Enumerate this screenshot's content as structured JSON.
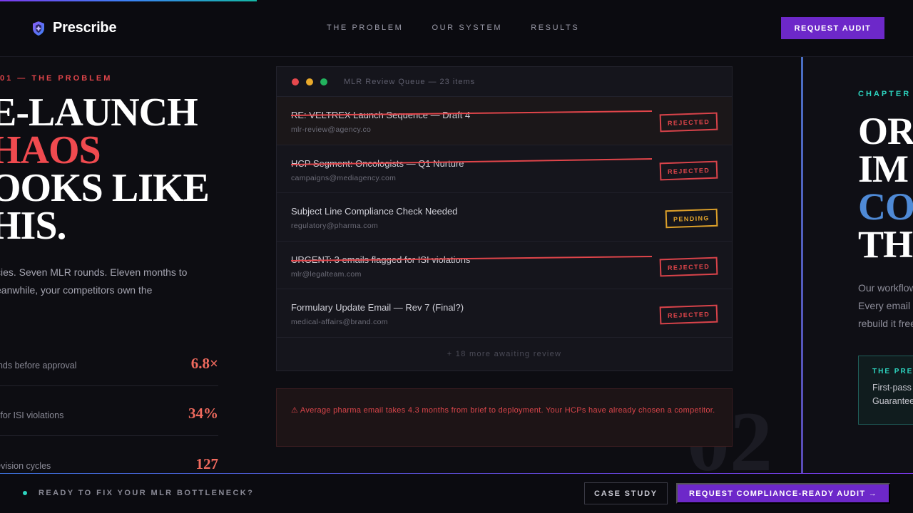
{
  "brand": {
    "name": "Prescribe",
    "logo_icon": "shield-pill-icon"
  },
  "nav": {
    "items": [
      "THE PROBLEM",
      "OUR SYSTEM",
      "RESULTS"
    ]
  },
  "header": {
    "cta_label": "REQUEST AUDIT"
  },
  "colors": {
    "accent": "#6d28c9",
    "danger": "#e0454a",
    "teal": "#2dd4bf",
    "warning": "#e3a52c",
    "blue": "#4f8ad6"
  },
  "problem": {
    "chapter": "01 — THE PROBLEM",
    "headline": {
      "line1": "E-LAUNCH",
      "line2": "HAOS",
      "line3": "OOKS LIKE",
      "line4": "HIS."
    },
    "lede": {
      "line1": "cies. Seven MLR rounds. Eleven months to",
      "line2": "eanwhile, your competitors own the"
    },
    "stats": [
      {
        "label": "unds before approval",
        "value": "6.8×"
      },
      {
        "label": "d for ISI violations",
        "value": "34%"
      },
      {
        "label": "revision cycles",
        "value": "127"
      }
    ]
  },
  "queue": {
    "title": "MLR Review Queue — 23 items",
    "items": [
      {
        "subject": "RE: VELTREX Launch Sequence — Draft 4",
        "from": "mlr-review@agency.co",
        "status": "REJECTED"
      },
      {
        "subject": "HCP Segment: Oncologists — Q1 Nurture",
        "from": "campaigns@mediagency.com",
        "status": "REJECTED"
      },
      {
        "subject": "Subject Line Compliance Check Needed",
        "from": "regulatory@pharma.com",
        "status": "PENDING"
      },
      {
        "subject": "URGENT: 3 emails flagged for ISI violations",
        "from": "mlr@legalteam.com",
        "status": "REJECTED"
      },
      {
        "subject": "Formulary Update Email — Rev 7 (Final?)",
        "from": "medical-affairs@brand.com",
        "status": "REJECTED"
      }
    ],
    "more": "+ 18 more awaiting review"
  },
  "warning": {
    "text": "⚠ Average pharma email takes 4.3 months from brief to deployment. Your HCPs have already chosen a competitor."
  },
  "ghost_number": "02",
  "system": {
    "chapter": "CHAPTER",
    "headline": {
      "line1": "OR",
      "line2": "IM",
      "line3": "CO",
      "line4": "TH"
    },
    "lede": {
      "line1": "Our workflow",
      "line2": "Every email",
      "line3": "rebuild it free"
    },
    "promise": {
      "title": "THE PRE",
      "line1": "First-pass",
      "line2": "Guarantee"
    }
  },
  "footer": {
    "cta_text": "READY TO FIX YOUR MLR BOTTLENECK?",
    "case_label": "CASE STUDY",
    "request_label": "REQUEST COMPLIANCE-READY AUDIT →"
  }
}
